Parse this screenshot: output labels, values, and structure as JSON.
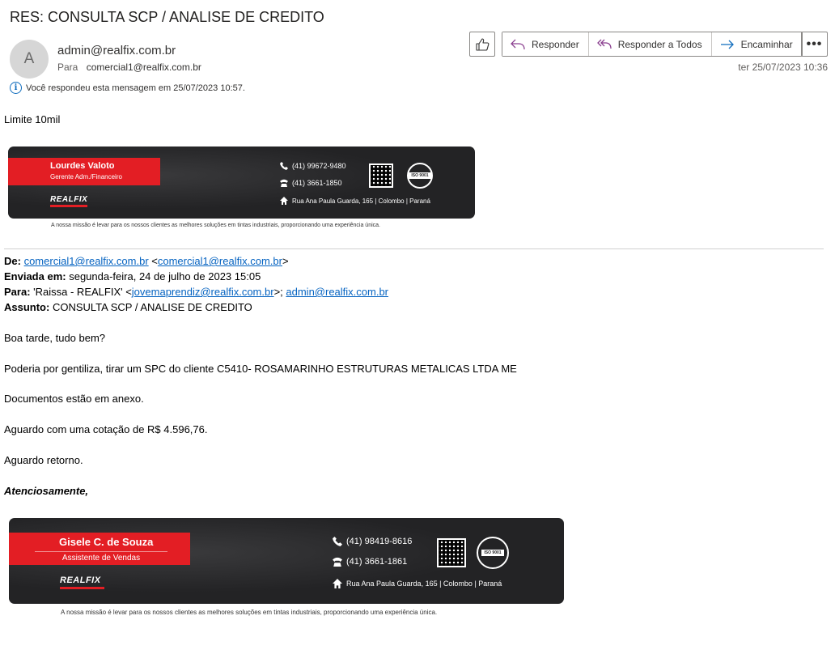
{
  "subject": "RES: CONSULTA SCP / ANALISE DE CREDITO",
  "sender": {
    "avatar_initial": "A",
    "email": "admin@realfix.com.br",
    "to_label": "Para",
    "to_value": "comercial1@realfix.com.br"
  },
  "replied_notice": "Você respondeu esta mensagem em 25/07/2023 10:57.",
  "toolbar": {
    "reply": "Responder",
    "reply_all": "Responder a Todos",
    "forward": "Encaminhar",
    "more": "•••"
  },
  "received_date": "ter 25/07/2023 10:36",
  "reply_body": "Limite 10mil",
  "signature1": {
    "name": "Lourdes Valoto",
    "role": "Gerente Adm./Financeiro",
    "logo": "REALFIX",
    "phone1": "(41) 99672-9480",
    "phone2": "(41) 3661-1850",
    "address": "Rua Ana Paula Guarda, 165 | Colombo | Paraná",
    "seal_text": "ISO 9001",
    "mission": "A nossa missão é levar para os nossos clientes as melhores soluções em tintas industriais, proporcionando uma experiência única."
  },
  "original": {
    "from_label": "De:",
    "from_name": "comercial1@realfix.com.br",
    "from_email": "comercial1@realfix.com.br",
    "sent_label": "Enviada em:",
    "sent_value": "segunda-feira, 24 de julho de 2023 15:05",
    "to_label": "Para:",
    "to_name": "'Raissa - REALFIX' <",
    "to_email1": "jovemaprendiz@realfix.com.br",
    "to_sep": ">; ",
    "to_email2": "admin@realfix.com.br",
    "subject_label": "Assunto:",
    "subject_value": "CONSULTA SCP / ANALISE DE CREDITO",
    "paragraphs": [
      "Boa tarde, tudo bem?",
      "Poderia por gentiliza, tirar um SPC do cliente C5410- ROSAMARINHO ESTRUTURAS METALICAS LTDA ME",
      "Documentos estão em anexo.",
      "Aguardo com uma cotação de R$ 4.596,76.",
      "Aguardo retorno."
    ],
    "closing": "Atenciosamente,"
  },
  "signature2": {
    "name": "Gisele C. de Souza",
    "role": "Assistente de Vendas",
    "logo": "REALFIX",
    "phone1": "(41) 98419-8616",
    "phone2": "(41) 3661-1861",
    "address": "Rua Ana Paula Guarda, 165 | Colombo | Paraná",
    "seal_text": "ISO 9001",
    "mission": "A nossa missão é levar para os nossos clientes as melhores soluções em tintas industriais, proporcionando uma experiência única."
  },
  "colors": {
    "accent_red": "#e31e24",
    "link_blue": "#0563c1",
    "signature_bg": "#232325"
  }
}
